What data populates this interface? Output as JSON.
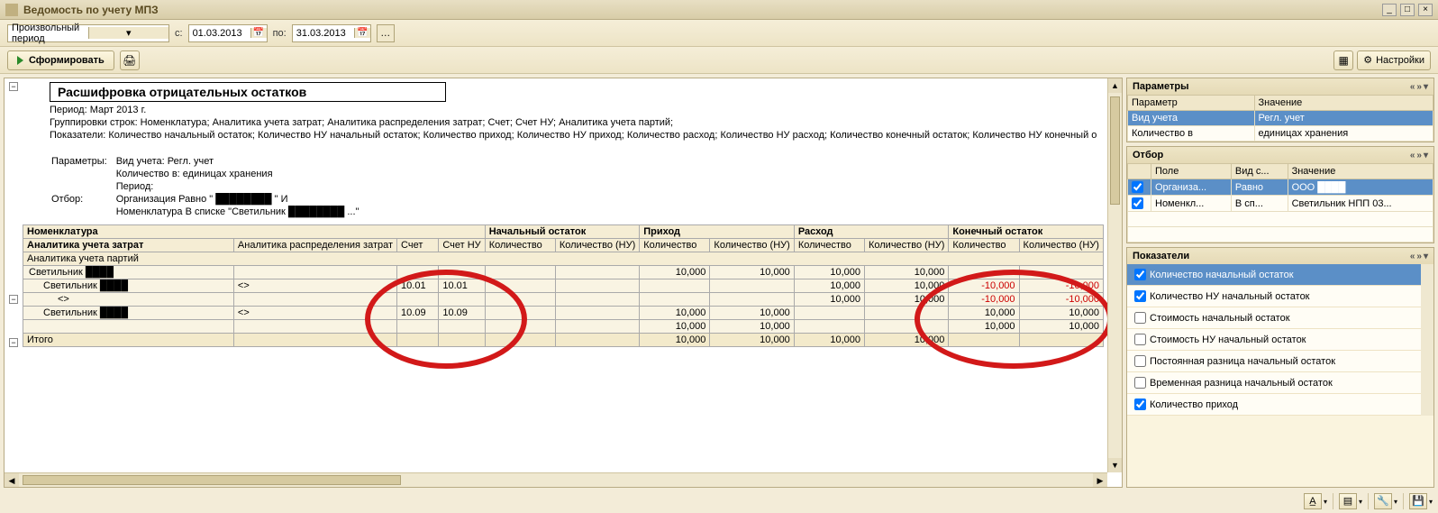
{
  "window": {
    "title": "Ведомость по учету МПЗ"
  },
  "period": {
    "mode": "Произвольный период",
    "from_label": "с:",
    "to_label": "по:",
    "from": "01.03.2013",
    "to": "31.03.2013"
  },
  "toolbar": {
    "generate": "Сформировать",
    "settings": "Настройки"
  },
  "report": {
    "title": "Расшифровка отрицательных остатков",
    "period_line": "Период: Март 2013 г.",
    "grouping_line": "Группировки строк: Номенклатура; Аналитика учета затрат; Аналитика распределения затрат; Счет; Счет НУ; Аналитика учета партий;",
    "indicators_line": "Показатели: Количество начальный остаток; Количество НУ начальный остаток; Количество приход; Количество НУ приход; Количество расход; Количество НУ расход; Количество конечный остаток; Количество НУ конечный о",
    "params_label": "Параметры:",
    "params": [
      "Вид учета: Регл. учет",
      "Количество в: единицах хранения",
      "Период:"
    ],
    "filter_label": "Отбор:",
    "filter": [
      "Организация Равно \" ████████ \" И",
      "Номенклатура В списке \"Светильник ████████ ...\""
    ],
    "columns": {
      "group_top": [
        "Номенклатура",
        "",
        "",
        "",
        "Начальный остаток",
        "",
        "Приход",
        "",
        "Расход",
        "",
        "Конечный остаток",
        ""
      ],
      "row2_left": "Аналитика учета затрат",
      "row2": [
        "Аналитика распределения затрат",
        "Счет",
        "Счет НУ",
        "Количество",
        "Количество (НУ)",
        "Количество",
        "Количество (НУ)",
        "Количество",
        "Количество (НУ)",
        "Количество",
        "Количество (НУ)"
      ],
      "row3_left": "Аналитика учета партий"
    },
    "rows": [
      {
        "lvl": 0,
        "cells": [
          "Светильник ████",
          "",
          "",
          "",
          "",
          "",
          "10,000",
          "10,000",
          "10,000",
          "10,000",
          "",
          ""
        ]
      },
      {
        "lvl": 1,
        "cells": [
          "Светильник ████",
          "<>",
          "10.01",
          "10.01",
          "",
          "",
          "",
          "",
          "10,000",
          "10,000",
          "-10,000",
          "-10,000"
        ],
        "neg": [
          10,
          11
        ]
      },
      {
        "lvl": 2,
        "cells": [
          "<>",
          "",
          "",
          "",
          "",
          "",
          "",
          "",
          "10,000",
          "10,000",
          "-10,000",
          "-10,000"
        ],
        "neg": [
          10,
          11
        ]
      },
      {
        "lvl": 1,
        "cells": [
          "Светильник ████",
          "<>",
          "10.09",
          "10.09",
          "",
          "",
          "10,000",
          "10,000",
          "",
          "",
          "10,000",
          "10,000"
        ]
      },
      {
        "lvl": 2,
        "cells": [
          "",
          "",
          "",
          "",
          "",
          "",
          "10,000",
          "10,000",
          "",
          "",
          "10,000",
          "10,000"
        ]
      }
    ],
    "total_label": "Итого",
    "total": [
      "",
      "",
      "",
      "",
      "",
      "10,000",
      "10,000",
      "10,000",
      "10,000",
      "",
      ""
    ]
  },
  "side": {
    "params": {
      "title": "Параметры",
      "cols": [
        "Параметр",
        "Значение"
      ],
      "rows": [
        {
          "k": "Вид учета",
          "v": "Регл. учет"
        },
        {
          "k": "Количество в",
          "v": "единицах хранения"
        }
      ]
    },
    "filter": {
      "title": "Отбор",
      "cols": [
        "Поле",
        "Вид с...",
        "Значение"
      ],
      "rows": [
        {
          "f": "Организа...",
          "c": "Равно",
          "v": "ООО ████"
        },
        {
          "f": "Номенкл...",
          "c": "В сп...",
          "v": "Светильник НПП 03..."
        }
      ]
    },
    "ind": {
      "title": "Показатели",
      "items": [
        {
          "label": "Количество начальный остаток",
          "checked": true,
          "sel": true
        },
        {
          "label": "Количество НУ начальный остаток",
          "checked": true
        },
        {
          "label": "Стоимость начальный остаток",
          "checked": false
        },
        {
          "label": "Стоимость НУ начальный остаток",
          "checked": false
        },
        {
          "label": "Постоянная разница начальный остаток",
          "checked": false
        },
        {
          "label": "Временная разница начальный остаток",
          "checked": false
        },
        {
          "label": "Количество приход",
          "checked": true
        }
      ]
    }
  }
}
